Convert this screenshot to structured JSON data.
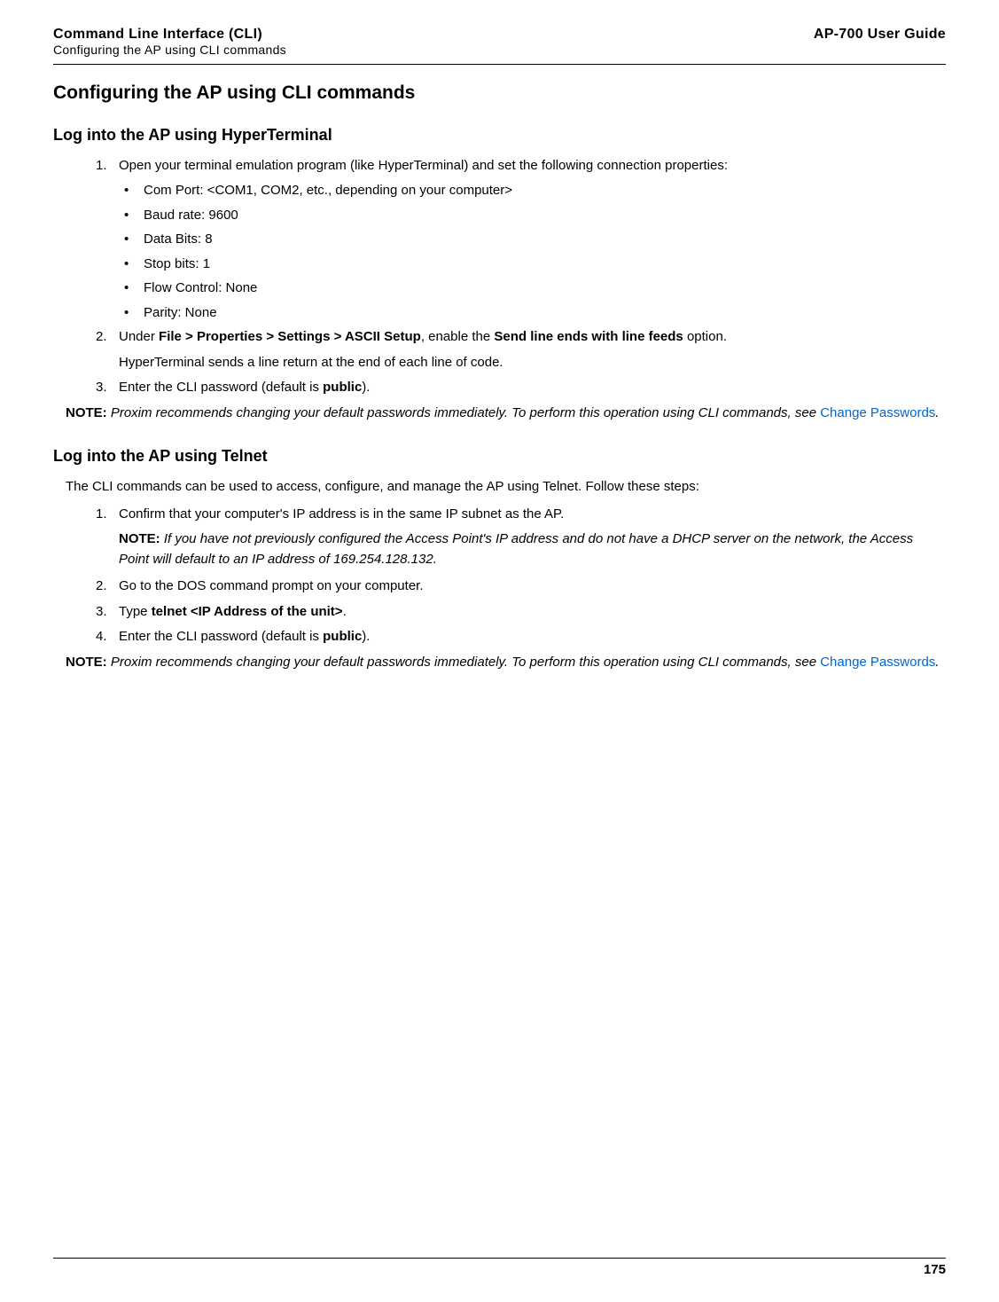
{
  "header": {
    "title": "Command Line Interface (CLI)",
    "subtitle": "Configuring the AP using CLI commands",
    "guide": "AP-700 User Guide"
  },
  "h1": "Configuring the AP using CLI commands",
  "section1": {
    "heading": "Log into the AP using HyperTerminal",
    "item1": "Open your terminal emulation program (like HyperTerminal) and set the following connection properties:",
    "bullets": {
      "b1": "Com Port: <COM1, COM2, etc., depending on your computer>",
      "b2": "Baud rate: 9600",
      "b3": "Data Bits: 8",
      "b4": "Stop bits: 1",
      "b5": "Flow Control: None",
      "b6": "Parity: None"
    },
    "item2_pre": "Under ",
    "item2_bold1": "File > Properties > Settings > ASCII Setup",
    "item2_mid": ", enable the ",
    "item2_bold2": "Send line ends with line feeds",
    "item2_post": " option.",
    "item2_cont": "HyperTerminal sends a line return at the end of each line of code.",
    "item3_pre": "Enter the CLI password (default is ",
    "item3_bold": "public",
    "item3_post": ").",
    "note_label": "NOTE:",
    "note_text_pre": " Proxim recommends changing your default passwords immediately. To perform this operation using CLI commands, see ",
    "note_link": "Change Passwords",
    "note_text_post": "."
  },
  "section2": {
    "heading": "Log into the AP using Telnet",
    "intro": "The CLI commands can be used to access, configure, and manage the AP using Telnet. Follow these steps:",
    "item1": "Confirm that your computer's IP address is in the same IP subnet as the AP.",
    "inline_note_label": "NOTE:",
    "inline_note_text": " If you have not previously configured the Access Point's IP address and do not have a DHCP server on the network, the Access Point will default to an IP address of 169.254.128.132.",
    "item2": "Go to the DOS command prompt on your computer.",
    "item3_pre": "Type ",
    "item3_bold": "telnet <IP Address of the unit>",
    "item3_post": ".",
    "item4_pre": "Enter the CLI password (default is ",
    "item4_bold": "public",
    "item4_post": ").",
    "note_label": "NOTE:",
    "note_text_pre": " Proxim recommends changing your default passwords immediately. To perform this operation using CLI commands, see ",
    "note_link": "Change Passwords",
    "note_text_post": "."
  },
  "page_number": "175",
  "numbers": {
    "n1": "1.",
    "n2": "2.",
    "n3": "3.",
    "n4": "4."
  },
  "bullet_char": "•"
}
